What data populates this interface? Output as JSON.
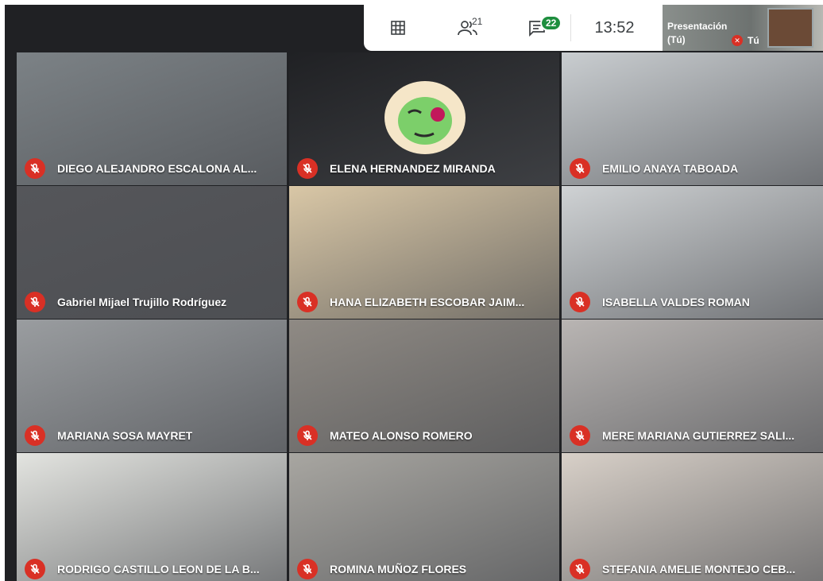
{
  "topbar": {
    "grid_icon": "grid-view-icon",
    "people_icon": "people-icon",
    "people_count": "21",
    "chat_icon": "chat-icon",
    "chat_count": "22",
    "time": "13:52"
  },
  "self_view": {
    "line1": "Presentación",
    "line2": "(Tú)",
    "muted_icon": "mic-off-icon",
    "name": "Tú"
  },
  "participants": [
    {
      "name": "DIEGO ALEJANDRO ESCALONA AL...",
      "scene": "#7c8286"
    },
    {
      "name": "ELENA HERNANDEZ MIRANDA",
      "scene": "#202124"
    },
    {
      "name": "EMILIO ANAYA TABOADA",
      "scene": "#c9cdd0"
    },
    {
      "name": "Gabriel Mijael Trujillo Rodríguez",
      "scene": "#55565a"
    },
    {
      "name": "HANA ELIZABETH ESCOBAR JAIM...",
      "scene": "#d9c7a6"
    },
    {
      "name": "ISABELLA VALDES ROMAN",
      "scene": "#cfd2d4"
    },
    {
      "name": "MARIANA SOSA MAYRET",
      "scene": "#9a9da0"
    },
    {
      "name": "MATEO ALONSO ROMERO",
      "scene": "#8f8a84"
    },
    {
      "name": "MERE MARIANA GUTIERREZ SALI...",
      "scene": "#b9b5b3"
    },
    {
      "name": "RODRIGO CASTILLO LEON DE LA B...",
      "scene": "#e3e4e0"
    },
    {
      "name": "ROMINA MUÑOZ FLORES",
      "scene": "#a8a6a1"
    },
    {
      "name": "STEFANIA AMELIE MONTEJO CEB...",
      "scene": "#d8d0c8"
    }
  ],
  "colors": {
    "mute_red": "#d93025",
    "chat_badge_green": "#1e8e3e",
    "stage_bg": "#202124"
  }
}
